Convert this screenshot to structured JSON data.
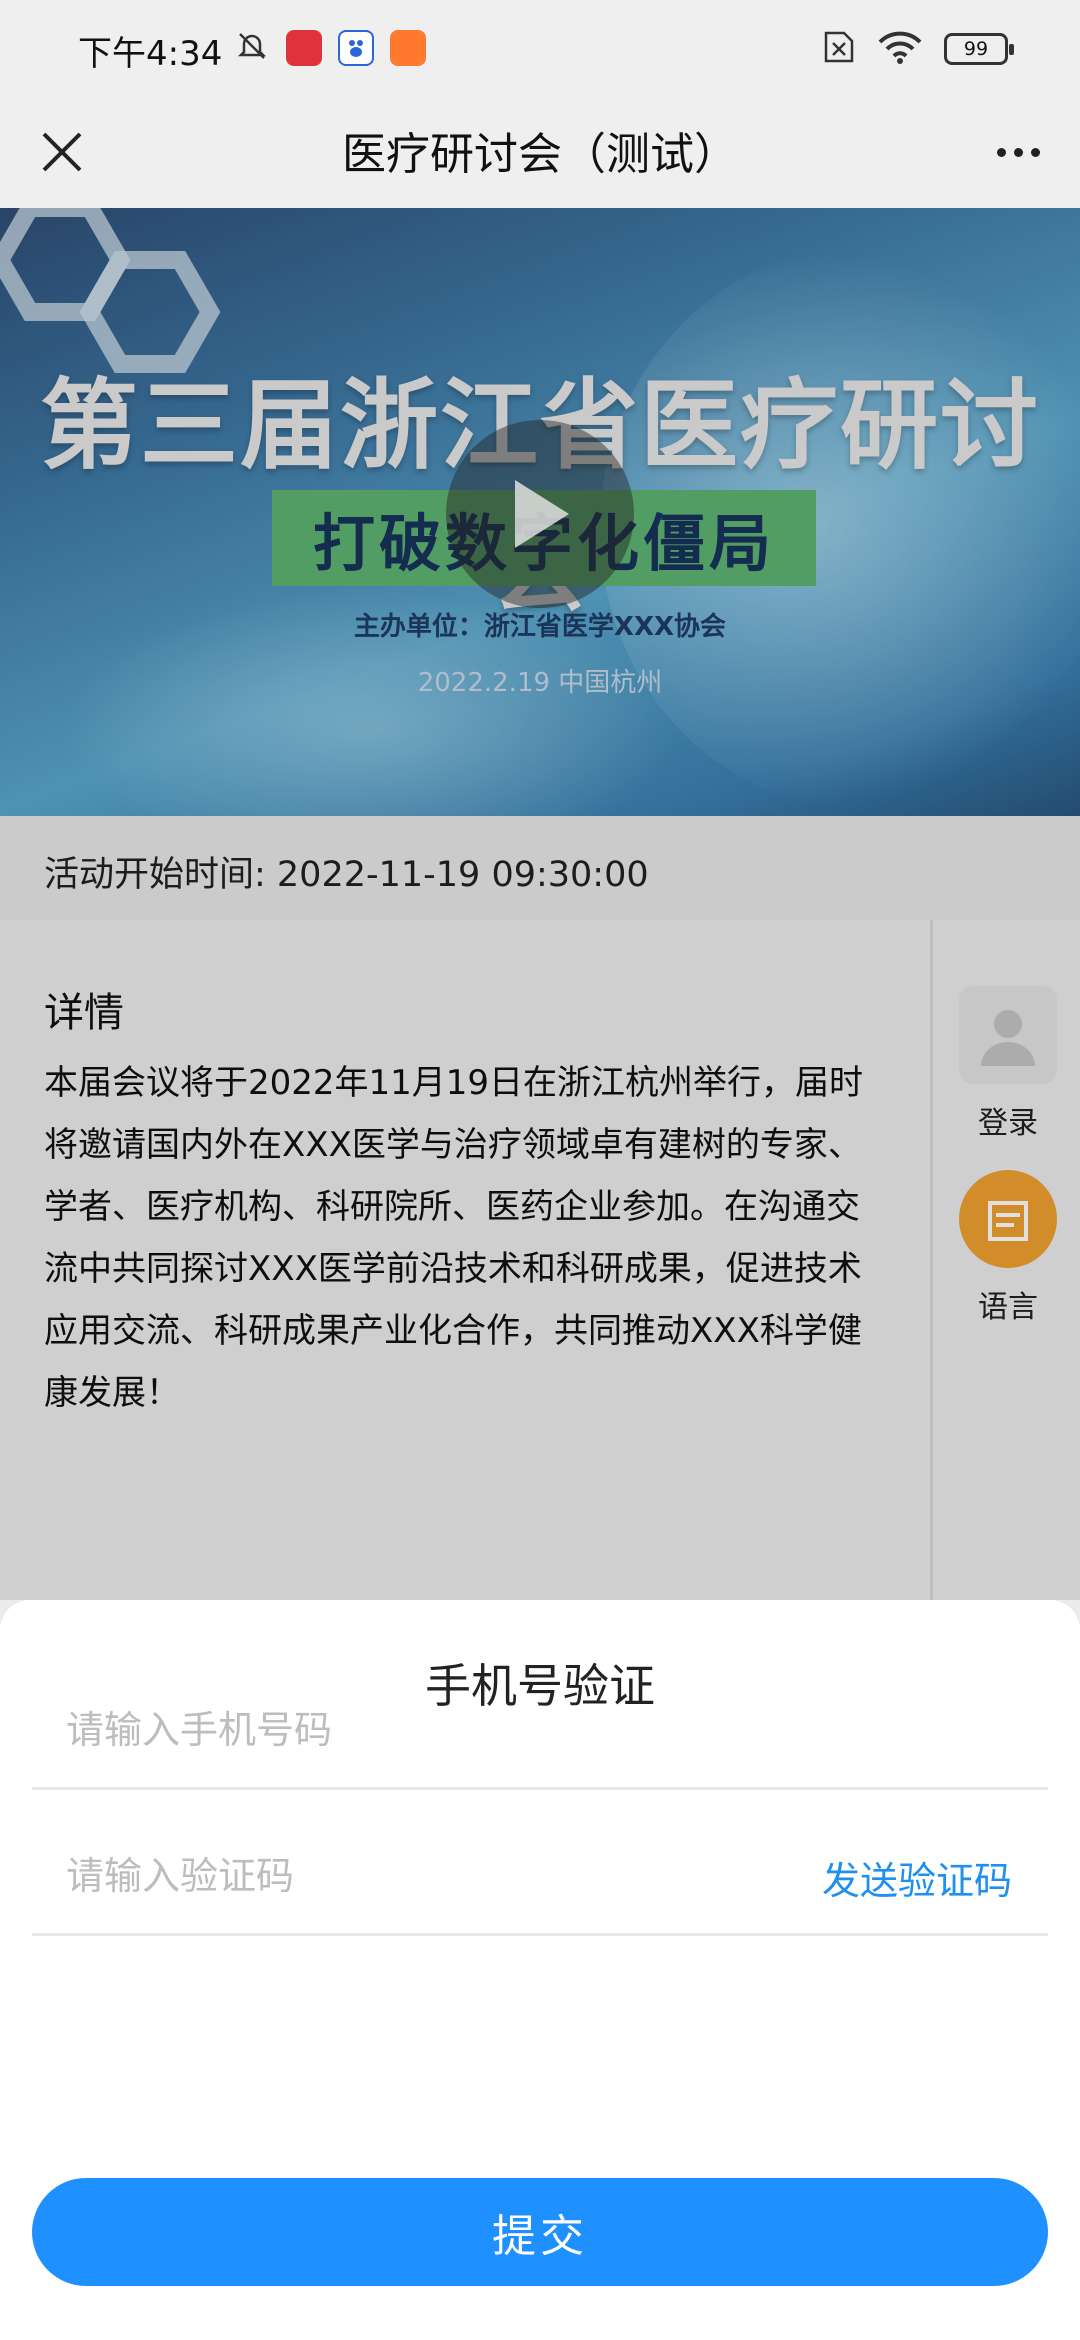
{
  "status_bar": {
    "time": "下午4:34",
    "battery": "99"
  },
  "nav": {
    "title": "医疗研讨会（测试）"
  },
  "banner": {
    "title": "第三届浙江省医疗研讨会",
    "subtitle": "打破数字化僵局",
    "host": "主办单位：浙江省医学XXX协会",
    "date_location": "2022.2.19  中国杭州"
  },
  "event": {
    "start_time": "活动开始时间: 2022-11-19 09:30:00",
    "detail_title": "详情",
    "detail_body": "本届会议将于2022年11月19日在浙江杭州举行，届时将邀请国内外在XXX医学与治疗领域卓有建树的专家、学者、医疗机构、科研院所、医药企业参加。在沟通交流中共同探讨XXX医学前沿技术和科研成果，促进技术应用交流、科研成果产业化合作，共同推动XXX科学健康发展！"
  },
  "sidebar": {
    "login_label": "登录",
    "language_label": "语言"
  },
  "sheet": {
    "title": "手机号验证",
    "phone_placeholder": "请输入手机号码",
    "code_placeholder": "请输入验证码",
    "send_code": "发送验证码",
    "submit": "提交"
  },
  "colors": {
    "accent": "#1e90ff",
    "link": "#1f8ff0",
    "banner_green": "#5eb372"
  }
}
